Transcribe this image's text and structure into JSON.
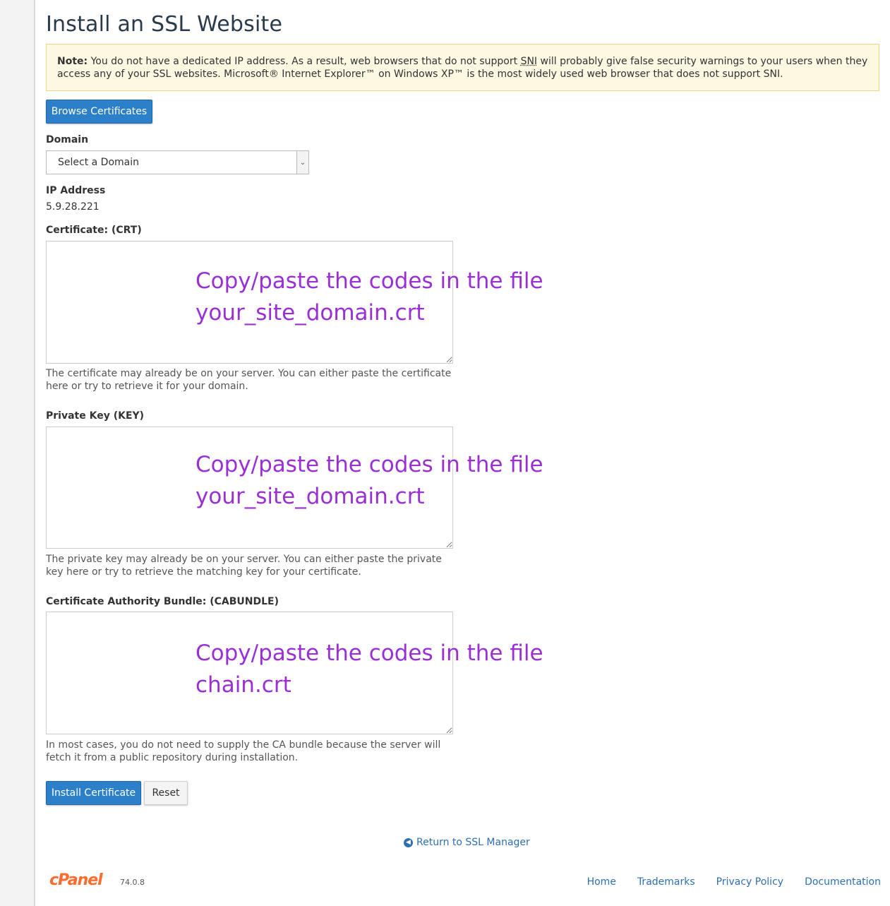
{
  "page": {
    "title": "Install an SSL Website"
  },
  "note": {
    "label": "Note:",
    "text_before": " You do not have a dedicated IP address. As a result, web browsers that do not support ",
    "sni": "SNI",
    "text_after": " will probably give false security warnings to your users when they access any of your SSL websites. Microsoft® Internet Explorer™ on Windows XP™ is the most widely used web browser that does not support SNI."
  },
  "browse_button": "Browse Certificates",
  "domain": {
    "label": "Domain",
    "selected": "Select a Domain"
  },
  "ip": {
    "label": "IP Address",
    "value": "5.9.28.221"
  },
  "certificate": {
    "label": "Certificate: (CRT)",
    "help": "The certificate may already be on your server. You can either paste the certificate here or try to retrieve it for your domain.",
    "overlay_line1": "Copy/paste the codes in the file",
    "overlay_line2": "your_site_domain.crt"
  },
  "private_key": {
    "label": "Private Key (KEY)",
    "help": "The private key may already be on your server. You can either paste the private key here or try to retrieve the matching key for your certificate.",
    "overlay_line1": "Copy/paste the codes in the file",
    "overlay_line2": "your_site_domain.crt"
  },
  "cabundle": {
    "label": "Certificate Authority Bundle: (CABUNDLE)",
    "help": "In most cases, you do not need to supply the CA bundle because the server will fetch it from a public repository during installation.",
    "overlay_line1": "Copy/paste the codes in the file",
    "overlay_line2": "chain.crt"
  },
  "actions": {
    "install": "Install Certificate",
    "reset": "Reset"
  },
  "return_link": "Return to SSL Manager",
  "footer": {
    "logo": "cPanel",
    "version": "74.0.8",
    "links": [
      "Home",
      "Trademarks",
      "Privacy Policy",
      "Documentation"
    ]
  }
}
